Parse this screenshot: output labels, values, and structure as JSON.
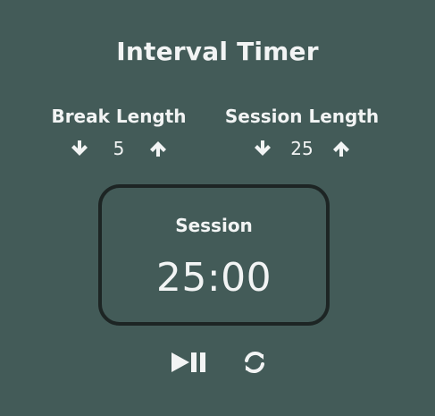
{
  "title": "Interval Timer",
  "break": {
    "label": "Break Length",
    "value": "5",
    "decrement_icon": "arrow-down-icon",
    "increment_icon": "arrow-up-icon"
  },
  "session": {
    "label": "Session Length",
    "value": "25",
    "decrement_icon": "arrow-down-icon",
    "increment_icon": "arrow-up-icon"
  },
  "timer": {
    "label": "Session",
    "display": "25:00"
  },
  "controls": {
    "play_pause_icon": "play-pause-icon",
    "reset_icon": "refresh-icon"
  },
  "colors": {
    "background": "#435b58",
    "text": "#f2f4f4",
    "timer_border": "#1d2524"
  }
}
